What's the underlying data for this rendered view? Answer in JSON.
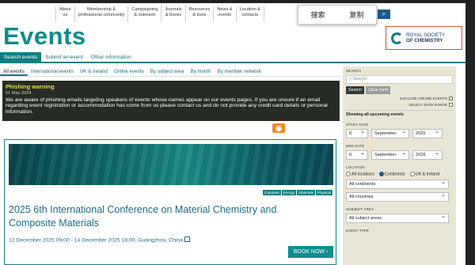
{
  "context_menu": [
    "搜索",
    "复制"
  ],
  "top_nav": [
    "About\nus",
    "Membership &\nprofessional community",
    "Campaigning\n& outreach",
    "Journals\n& books",
    "Resources\n& tools",
    "News &\nevents",
    "Location &\ncontacts"
  ],
  "page_title": "Events",
  "logo": {
    "line1": "ROYAL SOCIETY",
    "line2": "OF CHEMISTRY"
  },
  "tabs": [
    "Search events",
    "Submit an event",
    "Other information"
  ],
  "subtabs": [
    "All events",
    "International events",
    "UK & Ireland",
    "Online events",
    "By subject area",
    "By month",
    "By member network"
  ],
  "warning": {
    "title": "Phishing warning",
    "date": "01 May 2024",
    "body": "We are aware of phishing emails targeting speakers of events whose names appear on our events pages. If you are unsure if an email regarding event registration or accommodation has come from us please contact us and do not provide any credit card details or personal information."
  },
  "event": {
    "tags": [
      "Catalysis",
      "Energy",
      "Materials",
      "Physical"
    ],
    "title": "2025 6th International Conference on Material Chemistry and Composite Materials",
    "date": "12 December 2025 09:00 - 14 December 2025 18:00, Guangzhou, China",
    "book_label": "BOOK NOW ›"
  },
  "sidebar": {
    "search_label": "SEARCH",
    "search_placeholder": "Search",
    "search_btn": "Search",
    "clear_btn": "Clear form",
    "exclude_online": "EXCLUDE ONLINE EVENTS",
    "select_date_range": "SELECT DATE RANGE",
    "showing": "Showing all upcoming events",
    "start_date_label": "START DATE",
    "start": {
      "day": "8",
      "month": "September",
      "year": "2025"
    },
    "end_date_label": "END DATE",
    "end": {
      "day": "8",
      "month": "September",
      "year": "2026"
    },
    "location_label": "LOCATION",
    "radios": [
      "All locations",
      "Continents",
      "UK & Ireland"
    ],
    "continents": "All continents",
    "countries": "All countries",
    "subject_label": "SUBJECT AREA",
    "subject": "All subject areas",
    "event_type_label": "EVENT TYPE"
  },
  "colors": {
    "brand_teal": "#0f7f84",
    "warning_title": "#e2dd4e",
    "logo_border": "#e04b3a"
  }
}
